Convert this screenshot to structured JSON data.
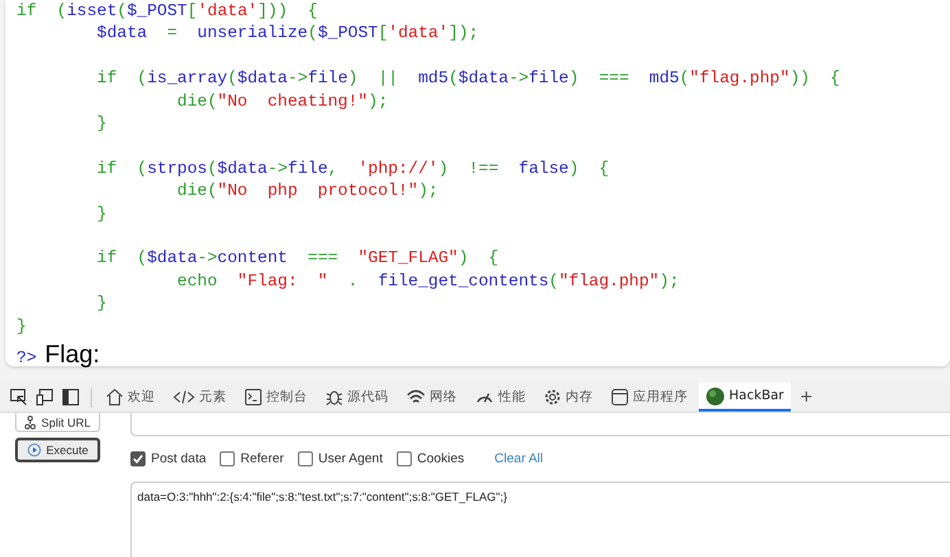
{
  "code_lines": [
    {
      "kind": "code",
      "tokens": [
        {
          "kind": "keyword",
          "text": "if  ("
        },
        {
          "kind": "default",
          "text": "isset"
        },
        {
          "kind": "keyword",
          "text": "("
        },
        {
          "kind": "default",
          "text": "$_POST"
        },
        {
          "kind": "keyword",
          "text": "["
        },
        {
          "kind": "string",
          "text": "'data'"
        },
        {
          "kind": "keyword",
          "text": "]))  {"
        }
      ]
    },
    {
      "kind": "code",
      "tokens": [
        {
          "kind": "default",
          "text": "        $data  "
        },
        {
          "kind": "keyword",
          "text": "=  "
        },
        {
          "kind": "default",
          "text": "unserialize"
        },
        {
          "kind": "keyword",
          "text": "("
        },
        {
          "kind": "default",
          "text": "$_POST"
        },
        {
          "kind": "keyword",
          "text": "["
        },
        {
          "kind": "string",
          "text": "'data'"
        },
        {
          "kind": "keyword",
          "text": "]);"
        }
      ]
    },
    {
      "kind": "blank"
    },
    {
      "kind": "code",
      "tokens": [
        {
          "kind": "keyword",
          "text": "        if  ("
        },
        {
          "kind": "default",
          "text": "is_array"
        },
        {
          "kind": "keyword",
          "text": "("
        },
        {
          "kind": "default",
          "text": "$data"
        },
        {
          "kind": "keyword",
          "text": "->"
        },
        {
          "kind": "default",
          "text": "file"
        },
        {
          "kind": "keyword",
          "text": ")  ||  "
        },
        {
          "kind": "default",
          "text": "md5"
        },
        {
          "kind": "keyword",
          "text": "("
        },
        {
          "kind": "default",
          "text": "$data"
        },
        {
          "kind": "keyword",
          "text": "->"
        },
        {
          "kind": "default",
          "text": "file"
        },
        {
          "kind": "keyword",
          "text": ")  ===  "
        },
        {
          "kind": "default",
          "text": "md5"
        },
        {
          "kind": "keyword",
          "text": "("
        },
        {
          "kind": "string",
          "text": "\"flag.php\""
        },
        {
          "kind": "keyword",
          "text": "))  {"
        }
      ]
    },
    {
      "kind": "code",
      "tokens": [
        {
          "kind": "keyword",
          "text": "                die("
        },
        {
          "kind": "string",
          "text": "\"No  cheating!\""
        },
        {
          "kind": "keyword",
          "text": ");"
        }
      ]
    },
    {
      "kind": "code",
      "tokens": [
        {
          "kind": "keyword",
          "text": "        }"
        }
      ]
    },
    {
      "kind": "blank"
    },
    {
      "kind": "code",
      "tokens": [
        {
          "kind": "keyword",
          "text": "        if  ("
        },
        {
          "kind": "default",
          "text": "strpos"
        },
        {
          "kind": "keyword",
          "text": "("
        },
        {
          "kind": "default",
          "text": "$data"
        },
        {
          "kind": "keyword",
          "text": "->"
        },
        {
          "kind": "default",
          "text": "file"
        },
        {
          "kind": "keyword",
          "text": ",  "
        },
        {
          "kind": "string",
          "text": "'php://'"
        },
        {
          "kind": "keyword",
          "text": ")  !==  "
        },
        {
          "kind": "default",
          "text": "false"
        },
        {
          "kind": "keyword",
          "text": ")  {"
        }
      ]
    },
    {
      "kind": "code",
      "tokens": [
        {
          "kind": "keyword",
          "text": "                die("
        },
        {
          "kind": "string",
          "text": "\"No  php  protocol!\""
        },
        {
          "kind": "keyword",
          "text": ");"
        }
      ]
    },
    {
      "kind": "code",
      "tokens": [
        {
          "kind": "keyword",
          "text": "        }"
        }
      ]
    },
    {
      "kind": "blank"
    },
    {
      "kind": "code",
      "tokens": [
        {
          "kind": "keyword",
          "text": "        if  ("
        },
        {
          "kind": "default",
          "text": "$data"
        },
        {
          "kind": "keyword",
          "text": "->"
        },
        {
          "kind": "default",
          "text": "content  "
        },
        {
          "kind": "keyword",
          "text": "===  "
        },
        {
          "kind": "string",
          "text": "\"GET_FLAG\""
        },
        {
          "kind": "keyword",
          "text": ")  {"
        }
      ]
    },
    {
      "kind": "code",
      "tokens": [
        {
          "kind": "keyword",
          "text": "                echo  "
        },
        {
          "kind": "string",
          "text": "\"Flag:  \""
        },
        {
          "kind": "keyword",
          "text": "  .  "
        },
        {
          "kind": "default",
          "text": "file_get_contents"
        },
        {
          "kind": "keyword",
          "text": "("
        },
        {
          "kind": "string",
          "text": "\"flag.php\""
        },
        {
          "kind": "keyword",
          "text": ");"
        }
      ]
    },
    {
      "kind": "code",
      "tokens": [
        {
          "kind": "keyword",
          "text": "        }"
        }
      ]
    },
    {
      "kind": "code",
      "tokens": [
        {
          "kind": "keyword",
          "text": "}"
        }
      ]
    }
  ],
  "php_close_tag": "?>",
  "output_text": "Flag:",
  "devtools_tabs": [
    {
      "label": "欢迎",
      "selected": false
    },
    {
      "label": "元素",
      "selected": false
    },
    {
      "label": "控制台",
      "selected": false
    },
    {
      "label": "源代码",
      "selected": false
    },
    {
      "label": "网络",
      "selected": false
    },
    {
      "label": "性能",
      "selected": false
    },
    {
      "label": "内存",
      "selected": false
    },
    {
      "label": "应用程序",
      "selected": false
    },
    {
      "label": "HackBar",
      "selected": true
    }
  ],
  "add_tab": "+",
  "hackbar": {
    "split_url_button": "Split URL",
    "execute_button": "Execute",
    "options": [
      {
        "label": "Post data",
        "checked": true
      },
      {
        "label": "Referer",
        "checked": false
      },
      {
        "label": "User Agent",
        "checked": false
      },
      {
        "label": "Cookies",
        "checked": false
      }
    ],
    "clear_all": "Clear All",
    "post_body": "data=O:3:\"hhh\":2:{s:4:\"file\";s:8:\"test.txt\";s:7:\"content\";s:8:\"GET_FLAG\";}"
  }
}
